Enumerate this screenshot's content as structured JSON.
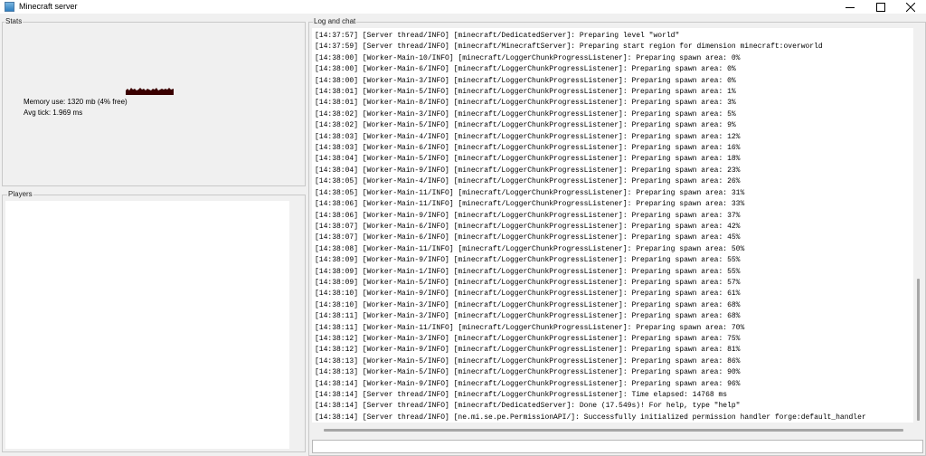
{
  "window": {
    "title": "Minecraft server"
  },
  "stats": {
    "label": "Stats",
    "memory_use": "Memory use: 1320 mb (4% free)",
    "avg_tick": "Avg tick: 1.969 ms"
  },
  "players": {
    "label": "Players",
    "items": []
  },
  "log": {
    "label": "Log and chat",
    "lines": [
      "[14:37:57] [Server thread/INFO] [minecraft/DedicatedServer]: Preparing level \"world\"",
      "[14:37:59] [Server thread/INFO] [minecraft/MinecraftServer]: Preparing start region for dimension minecraft:overworld",
      "[14:38:00] [Worker-Main-10/INFO] [minecraft/LoggerChunkProgressListener]: Preparing spawn area: 0%",
      "[14:38:00] [Worker-Main-6/INFO] [minecraft/LoggerChunkProgressListener]: Preparing spawn area: 0%",
      "[14:38:00] [Worker-Main-3/INFO] [minecraft/LoggerChunkProgressListener]: Preparing spawn area: 0%",
      "[14:38:01] [Worker-Main-5/INFO] [minecraft/LoggerChunkProgressListener]: Preparing spawn area: 1%",
      "[14:38:01] [Worker-Main-8/INFO] [minecraft/LoggerChunkProgressListener]: Preparing spawn area: 3%",
      "[14:38:02] [Worker-Main-3/INFO] [minecraft/LoggerChunkProgressListener]: Preparing spawn area: 5%",
      "[14:38:02] [Worker-Main-5/INFO] [minecraft/LoggerChunkProgressListener]: Preparing spawn area: 9%",
      "[14:38:03] [Worker-Main-4/INFO] [minecraft/LoggerChunkProgressListener]: Preparing spawn area: 12%",
      "[14:38:03] [Worker-Main-6/INFO] [minecraft/LoggerChunkProgressListener]: Preparing spawn area: 16%",
      "[14:38:04] [Worker-Main-5/INFO] [minecraft/LoggerChunkProgressListener]: Preparing spawn area: 18%",
      "[14:38:04] [Worker-Main-9/INFO] [minecraft/LoggerChunkProgressListener]: Preparing spawn area: 23%",
      "[14:38:05] [Worker-Main-4/INFO] [minecraft/LoggerChunkProgressListener]: Preparing spawn area: 26%",
      "[14:38:05] [Worker-Main-11/INFO] [minecraft/LoggerChunkProgressListener]: Preparing spawn area: 31%",
      "[14:38:06] [Worker-Main-11/INFO] [minecraft/LoggerChunkProgressListener]: Preparing spawn area: 33%",
      "[14:38:06] [Worker-Main-9/INFO] [minecraft/LoggerChunkProgressListener]: Preparing spawn area: 37%",
      "[14:38:07] [Worker-Main-6/INFO] [minecraft/LoggerChunkProgressListener]: Preparing spawn area: 42%",
      "[14:38:07] [Worker-Main-6/INFO] [minecraft/LoggerChunkProgressListener]: Preparing spawn area: 45%",
      "[14:38:08] [Worker-Main-11/INFO] [minecraft/LoggerChunkProgressListener]: Preparing spawn area: 50%",
      "[14:38:09] [Worker-Main-9/INFO] [minecraft/LoggerChunkProgressListener]: Preparing spawn area: 55%",
      "[14:38:09] [Worker-Main-1/INFO] [minecraft/LoggerChunkProgressListener]: Preparing spawn area: 55%",
      "[14:38:09] [Worker-Main-5/INFO] [minecraft/LoggerChunkProgressListener]: Preparing spawn area: 57%",
      "[14:38:10] [Worker-Main-9/INFO] [minecraft/LoggerChunkProgressListener]: Preparing spawn area: 61%",
      "[14:38:10] [Worker-Main-3/INFO] [minecraft/LoggerChunkProgressListener]: Preparing spawn area: 68%",
      "[14:38:11] [Worker-Main-3/INFO] [minecraft/LoggerChunkProgressListener]: Preparing spawn area: 68%",
      "[14:38:11] [Worker-Main-11/INFO] [minecraft/LoggerChunkProgressListener]: Preparing spawn area: 70%",
      "[14:38:12] [Worker-Main-3/INFO] [minecraft/LoggerChunkProgressListener]: Preparing spawn area: 75%",
      "[14:38:12] [Worker-Main-9/INFO] [minecraft/LoggerChunkProgressListener]: Preparing spawn area: 81%",
      "[14:38:13] [Worker-Main-5/INFO] [minecraft/LoggerChunkProgressListener]: Preparing spawn area: 86%",
      "[14:38:13] [Worker-Main-5/INFO] [minecraft/LoggerChunkProgressListener]: Preparing spawn area: 90%",
      "[14:38:14] [Worker-Main-9/INFO] [minecraft/LoggerChunkProgressListener]: Preparing spawn area: 96%",
      "[14:38:14] [Server thread/INFO] [minecraft/LoggerChunkProgressListener]: Time elapsed: 14768 ms",
      "[14:38:14] [Server thread/INFO] [minecraft/DedicatedServer]: Done (17.549s)! For help, type \"help\"",
      "[14:38:14] [Server thread/INFO] [ne.mi.se.pe.PermissionAPI/]: Successfully initialized permission handler forge:default_handler"
    ]
  },
  "command_input": {
    "value": ""
  },
  "icons": {
    "app": "java-cup-icon",
    "minimize": "minimize-icon",
    "maximize": "maximize-icon",
    "close": "close-icon"
  }
}
